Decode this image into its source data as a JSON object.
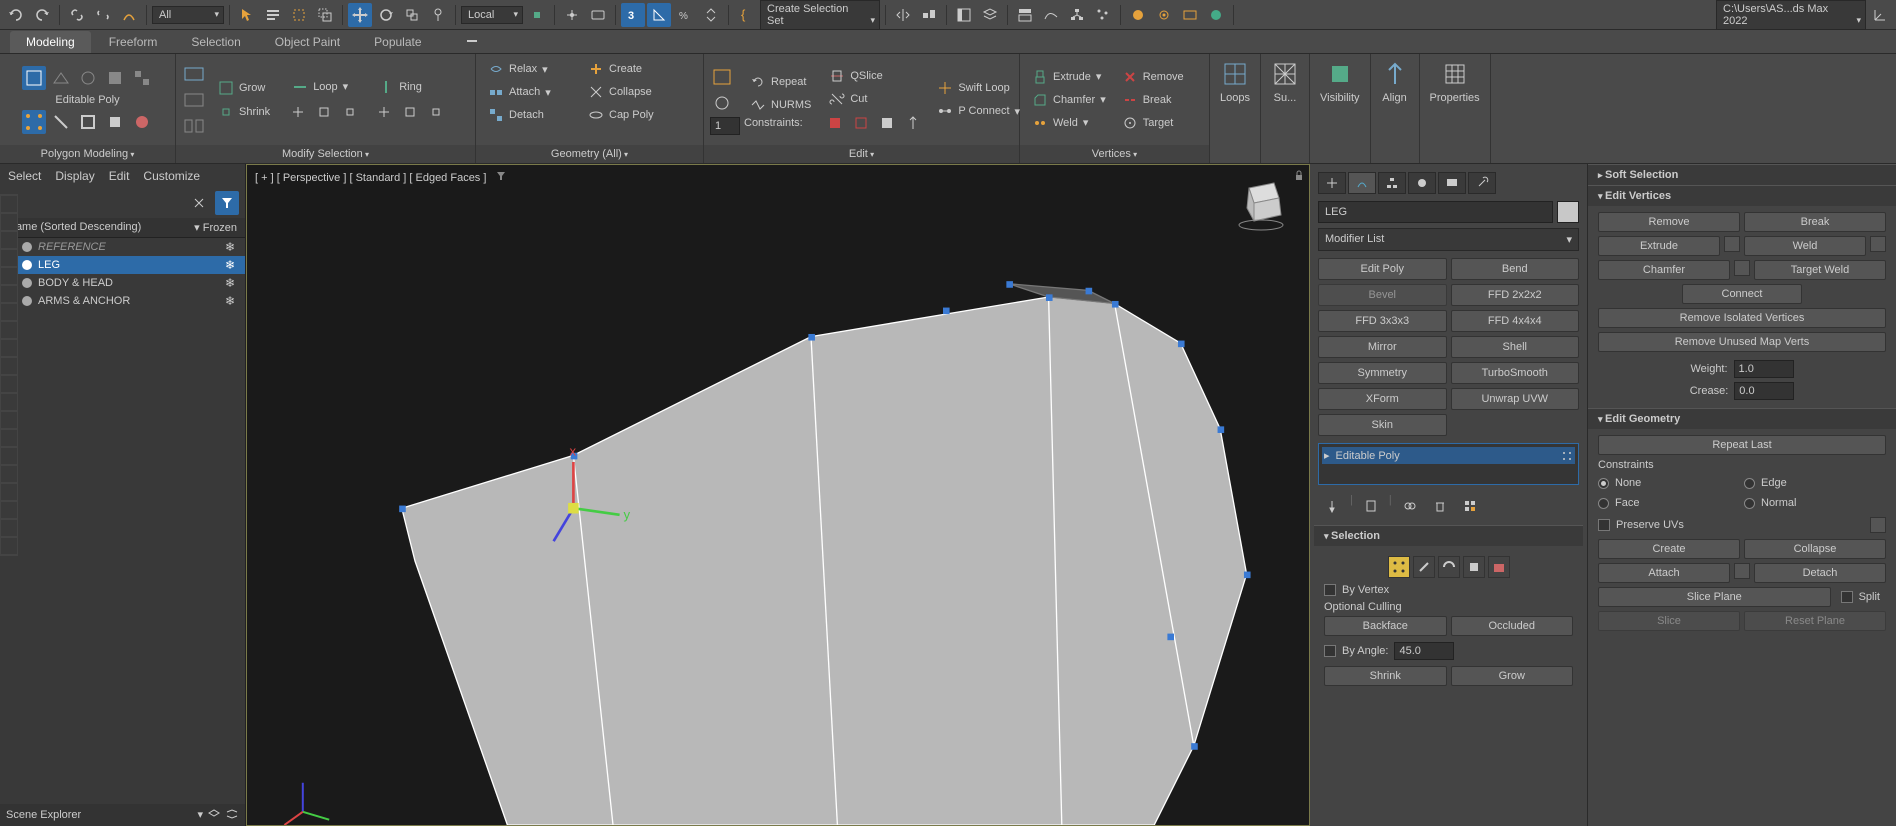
{
  "app_path": "C:\\Users\\AS...ds Max 2022",
  "toolbar": {
    "dropdown_all": "All",
    "dropdown_local": "Local",
    "create_sel_set": "Create Selection Set"
  },
  "ribbon": {
    "tabs": [
      "Modeling",
      "Freeform",
      "Selection",
      "Object Paint",
      "Populate"
    ],
    "active_tab": 0,
    "editable_poly": "Editable Poly",
    "groups": {
      "polygon_modeling": "Polygon Modeling",
      "modify_selection": "Modify Selection",
      "geometry": "Geometry (All)",
      "edit": "Edit",
      "vertices": "Vertices"
    },
    "grow": "Grow",
    "shrink": "Shrink",
    "loop": "Loop",
    "ring": "Ring",
    "relax": "Relax",
    "attach": "Attach",
    "detach": "Detach",
    "create": "Create",
    "collapse": "Collapse",
    "cap_poly": "Cap Poly",
    "repeat": "Repeat",
    "nurms": "NURMS",
    "constraints": "Constraints:",
    "qslice": "QSlice",
    "cut": "Cut",
    "swift_loop": "Swift Loop",
    "p_connect": "P Connect",
    "extrude": "Extrude",
    "chamfer": "Chamfer",
    "weld": "Weld",
    "remove": "Remove",
    "break": "Break",
    "target": "Target",
    "loops": "Loops",
    "subdiv": "Su...",
    "visibility": "Visibility",
    "align": "Align",
    "properties": "Properties",
    "spinner_val": "1"
  },
  "scene_explorer": {
    "menu": [
      "Select",
      "Display",
      "Edit",
      "Customize"
    ],
    "col_name": "Name (Sorted Descending)",
    "col_frozen": "Frozen",
    "items": [
      {
        "name": "REFERENCE",
        "visible": false,
        "selected": false,
        "italic": true
      },
      {
        "name": "LEG",
        "visible": true,
        "selected": true,
        "italic": false
      },
      {
        "name": "BODY & HEAD",
        "visible": false,
        "selected": false,
        "italic": false
      },
      {
        "name": "ARMS & ANCHOR",
        "visible": false,
        "selected": false,
        "italic": false
      }
    ],
    "footer": "Scene Explorer"
  },
  "viewport": {
    "label": "[ + ] [ Perspective ] [ Standard ] [ Edged Faces ]"
  },
  "command_panel": {
    "object_name": "LEG",
    "modifier_list": "Modifier List",
    "mod_buttons": [
      "Edit Poly",
      "Bend",
      "Bevel",
      "FFD 2x2x2",
      "FFD 3x3x3",
      "FFD 4x4x4",
      "Mirror",
      "Shell",
      "Symmetry",
      "TurboSmooth",
      "XForm",
      "Unwrap UVW",
      "Skin"
    ],
    "stack_item": "Editable Poly",
    "selection_title": "Selection",
    "by_vertex": "By Vertex",
    "optional_culling": "Optional Culling",
    "backface": "Backface",
    "occluded": "Occluded",
    "by_angle": "By Angle:",
    "angle_val": "45.0",
    "shrink_btn": "Shrink",
    "grow_btn": "Grow"
  },
  "soft_sel": {
    "title": "Soft Selection"
  },
  "edit_verts": {
    "title": "Edit Vertices",
    "remove": "Remove",
    "break": "Break",
    "extrude": "Extrude",
    "weld": "Weld",
    "chamfer": "Chamfer",
    "target_weld": "Target Weld",
    "connect": "Connect",
    "rem_iso": "Remove Isolated Vertices",
    "rem_unused": "Remove Unused Map Verts",
    "weight": "Weight:",
    "weight_val": "1.0",
    "crease": "Crease:",
    "crease_val": "0.0"
  },
  "edit_geom": {
    "title": "Edit Geometry",
    "repeat_last": "Repeat Last",
    "constraints": "Constraints",
    "none": "None",
    "edge": "Edge",
    "face": "Face",
    "normal": "Normal",
    "preserve_uvs": "Preserve UVs",
    "create": "Create",
    "collapse": "Collapse",
    "attach": "Attach",
    "detach": "Detach",
    "slice_plane": "Slice Plane",
    "split": "Split",
    "slice": "Slice",
    "reset_plane": "Reset Plane"
  }
}
